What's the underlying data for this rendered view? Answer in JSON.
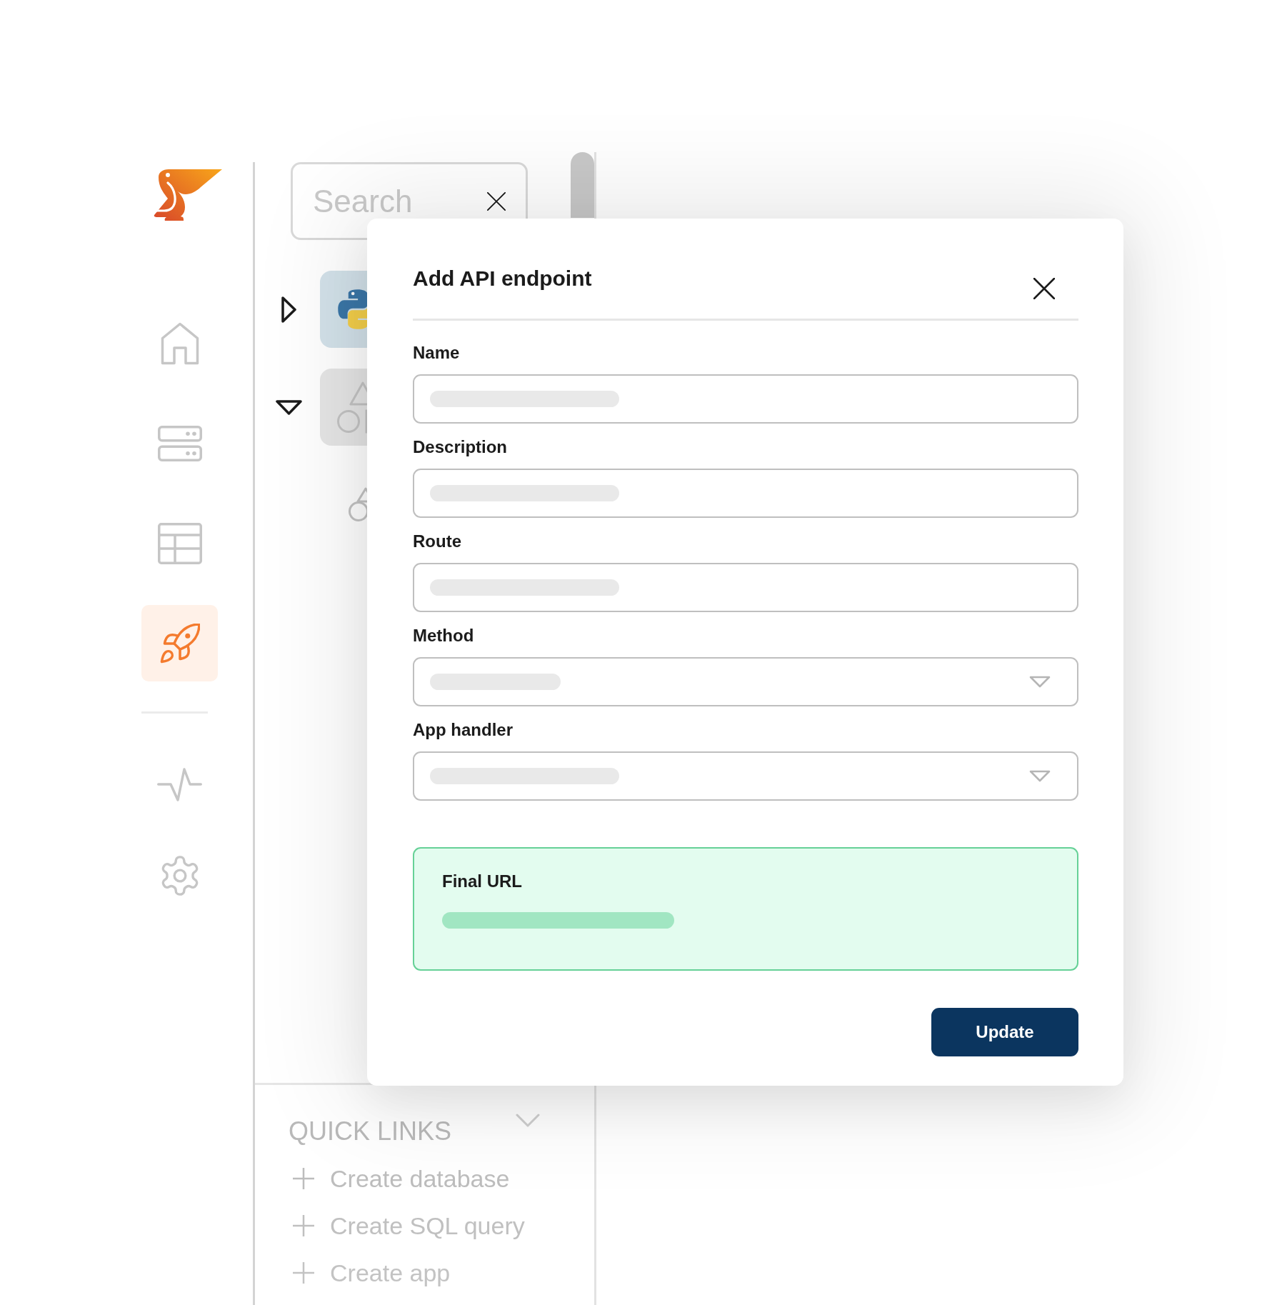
{
  "sidebar": {
    "items": [
      {
        "selected": false
      },
      {
        "selected": false
      },
      {
        "selected": false
      },
      {
        "selected": true
      }
    ],
    "footer_items": [
      {
        "selected": false
      },
      {
        "selected": false
      }
    ]
  },
  "search": {
    "placeholder": "Search"
  },
  "tree": {
    "items": [
      {
        "kind": "python",
        "expanded": false
      },
      {
        "kind": "shapes",
        "expanded": true,
        "children": [
          {
            "kind": "shapes"
          }
        ]
      }
    ]
  },
  "quick_links": {
    "title": "QUICK LINKS",
    "expanded": true,
    "items": [
      "Create database",
      "Create SQL query",
      "Create app"
    ]
  },
  "dialog": {
    "title": "Add API endpoint",
    "fields": [
      {
        "label": "Name",
        "kind": "text"
      },
      {
        "label": "Description",
        "kind": "text"
      },
      {
        "label": "Route",
        "kind": "text"
      },
      {
        "label": "Method",
        "kind": "select"
      },
      {
        "label": "App handler",
        "kind": "select"
      }
    ],
    "final_url": {
      "label": "Final URL"
    },
    "buttons": [
      "Update"
    ]
  }
}
